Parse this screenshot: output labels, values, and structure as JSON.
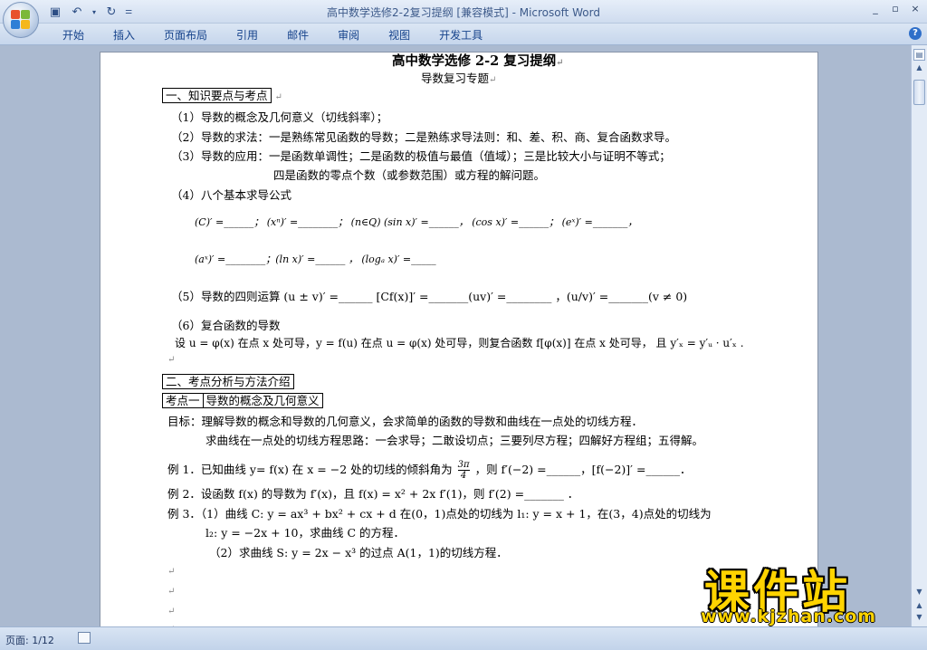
{
  "window": {
    "title": "高中数学选修2-2复习提纲 [兼容模式] - Microsoft Word",
    "controls": [
      "_",
      "▫",
      "×"
    ]
  },
  "qat": {
    "save_icon": "save-icon",
    "undo_icon": "undo-icon",
    "redo_icon": "redo-icon"
  },
  "ribbon": {
    "tabs": [
      "开始",
      "插入",
      "页面布局",
      "引用",
      "邮件",
      "审阅",
      "视图",
      "开发工具"
    ]
  },
  "document": {
    "title": "高中数学选修 2-2 复习提纲",
    "subtitle": "导数复习专题",
    "section1": "一、知识要点与考点",
    "item1": "（1）导数的概念及几何意义（切线斜率）；",
    "item2": "（2）导数的求法：一是熟练常见函数的导数；二是熟练求导法则：和、差、积、商、复合函数求导。",
    "item3": "（3）导数的应用：一是函数单调性；二是函数的极值与最值（值域）；三是比较大小与证明不等式；",
    "item3b": "四是函数的零点个数（或参数范围）或方程的解问题。",
    "item4": "（4）八个基本求导公式",
    "formula_row1": "(C)′ =______；  (xⁿ)′ =________；  (n∈Q)   (sin x)′ =______，   (cos x)′ =______；   (eˣ)′ =_______，",
    "formula_row2": "(aˣ)′ =________；(ln x)′ =______ ，   (logₐ x)′ =_____",
    "item5": "（5）导数的四则运算  (u ± v)′ =______   [Cf(x)]′ =_______(uv)′ =________   ，(u/v)′ =_______(v ≠ 0)",
    "item6": "（6）复合函数的导数",
    "item6_text": "设 u = φ(x) 在点 x 处可导，y = f(u) 在点 u = φ(x) 处可导，则复合函数 f[φ(x)] 在点 x 处可导，  且 y′ₓ = y′ᵤ · u′ₓ .",
    "section2": "二、考点分析与方法介绍",
    "kaodian_label": "考点一",
    "kaodian_title": "导数的概念及几何意义",
    "goal1": "目标：理解导数的概念和导数的几何意义，会求简单的函数的导数和曲线在一点处的切线方程．",
    "goal2": "求曲线在一点处的切线方程思路：一会求导；二敢设切点；三要列尽方程；四解好方程组；五得解。",
    "ex1_a": "例 1．已知曲线 y=  f(x) 在 x = −2 处的切线的倾斜角为",
    "ex1_num": "3π",
    "ex1_den": "4",
    "ex1_b": "，则 f′(−2) =______，[f(−2)]′ =______．",
    "ex2": "例 2．设函数 f(x) 的导数为 f′(x)，且 f(x) = x² + 2x f′(1)，则 f′(2) =_______  ．",
    "ex3a": "例 3．（1）曲线 C: y = ax³ + bx² + cx + d 在(0，1)点处的切线为 l₁: y = x + 1，在(3，4)点处的切线为",
    "ex3b": "l₂: y = −2x + 10，求曲线 C 的方程．",
    "ex3c": "（2）求曲线 S: y = 2x − x³ 的过点 A(1，1)的切线方程．",
    "para_mark": "↵"
  },
  "status": {
    "page": "页面: 1/12"
  },
  "watermark": {
    "text": "课件站",
    "url": "www.kjzhan.com"
  }
}
